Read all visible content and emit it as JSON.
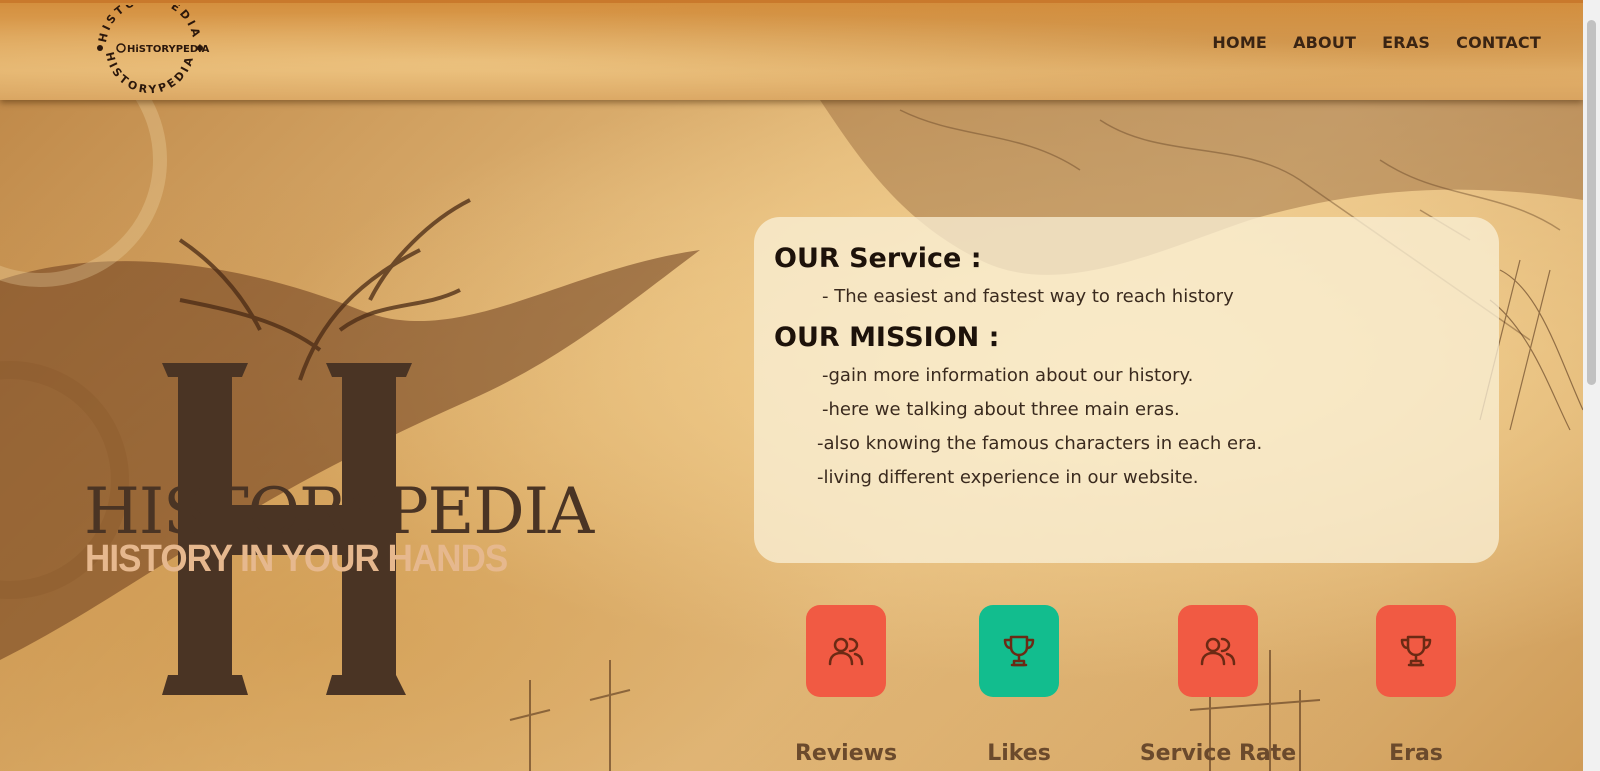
{
  "brand": {
    "logo_text": "HiSTORYPEDiA",
    "big_letter": "H",
    "name": "HISTORYPEDIA",
    "tagline": "HISTORY IN YOUR HANDS"
  },
  "nav": {
    "items": [
      {
        "label": "HOME"
      },
      {
        "label": "ABOUT"
      },
      {
        "label": "ERAS"
      },
      {
        "label": "CONTACT"
      }
    ]
  },
  "card": {
    "service_heading": "OUR Service :",
    "service_text": "- The easiest and fastest way to reach history",
    "mission_heading": "OUR MISSION :",
    "mission_items": [
      "-gain more information about our history.",
      "-here we talking about three main eras.",
      "-also knowing the famous characters in each era.",
      "-living different experience in our website."
    ]
  },
  "stats": [
    {
      "label": "Reviews",
      "icon": "users-icon",
      "color": "#f15a43"
    },
    {
      "label": "Likes",
      "icon": "trophy-icon",
      "color": "#12bd8e"
    },
    {
      "label": "Service Rate",
      "icon": "users-icon",
      "color": "#f15a43"
    },
    {
      "label": "Eras",
      "icon": "trophy-icon",
      "color": "#f15a43"
    }
  ]
}
